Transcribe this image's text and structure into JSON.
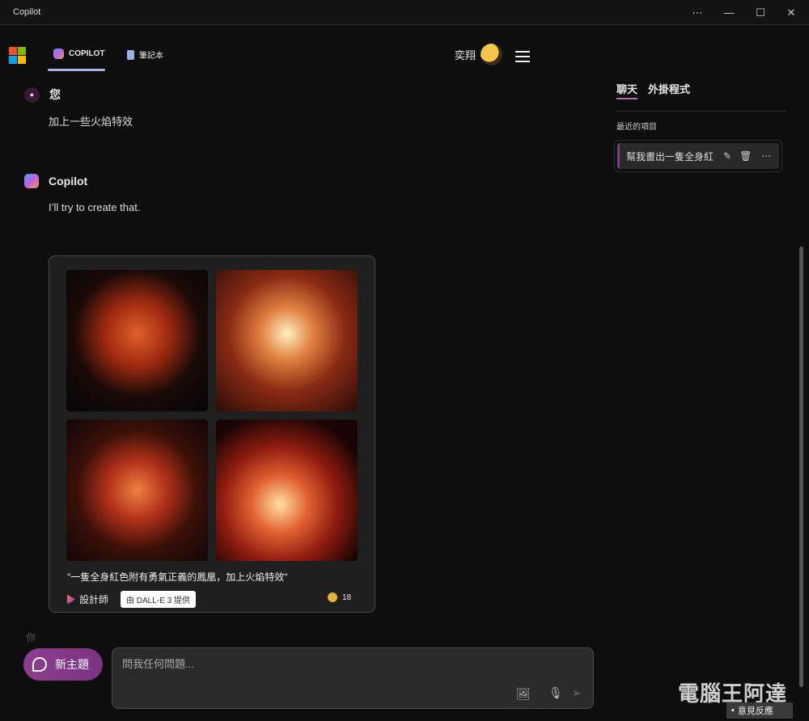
{
  "window": {
    "title": "Copilot",
    "controls": [
      "more",
      "minimize",
      "maximize",
      "close"
    ]
  },
  "nav": {
    "tabs": [
      {
        "label": "COPILOT",
        "icon": "copilot-icon",
        "active": true
      },
      {
        "label": "筆記本",
        "icon": "notebook-icon",
        "active": false
      }
    ],
    "user_name": "奕翔"
  },
  "chat": [
    {
      "author": "您",
      "text": "加上一些火焰特效"
    },
    {
      "author": "Copilot",
      "text": "I’ll try to create that."
    }
  ],
  "image_card": {
    "images": [
      "phoenix-image-1",
      "phoenix-image-2",
      "phoenix-image-3",
      "phoenix-image-4"
    ],
    "caption": "\"一隻全身紅色附有勇氣正義的鳳凰，加上火焰特效\"",
    "designer_label": "設計師",
    "dalle_badge": "由 DALL-E 3 提供",
    "boost_count": "18"
  },
  "ghost_author": "你",
  "composer": {
    "new_topic": "新主題",
    "placeholder": "問我任何問題..."
  },
  "sidebar": {
    "tabs": [
      "聊天",
      "外掛程式"
    ],
    "recent_label": "最近的項目",
    "recent_items": [
      {
        "title": "幫我畫出一隻全身紅"
      }
    ]
  },
  "feedback": "意見反應",
  "watermark": "電腦王阿達",
  "colors": {
    "accent": "#8e3d8e",
    "background": "#0f0e0e",
    "tab_underline": "#aab3e6"
  }
}
